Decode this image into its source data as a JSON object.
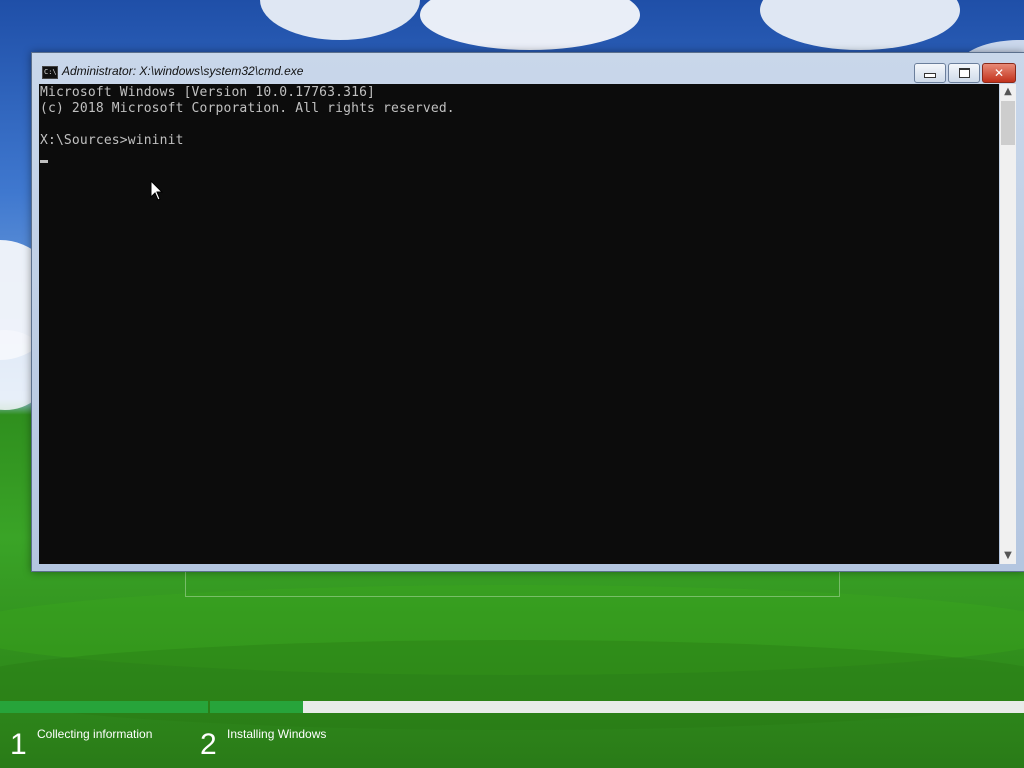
{
  "window": {
    "title": "Administrator: X:\\windows\\system32\\cmd.exe",
    "icon": "cmd-icon",
    "icon_text": "C:\\"
  },
  "console": {
    "lines": [
      "Microsoft Windows [Version 10.0.17763.316]",
      "(c) 2018 Microsoft Corporation. All rights reserved.",
      "",
      "X:\\Sources>wininit"
    ],
    "text_color": "#c0c0c0",
    "background": "#0c0c0c"
  },
  "setup": {
    "steps": [
      {
        "number": "1",
        "label": "Collecting information",
        "progress": 1.0
      },
      {
        "number": "2",
        "label": "Installing Windows",
        "progress": 0.114
      }
    ],
    "accent": "#27a43a"
  }
}
